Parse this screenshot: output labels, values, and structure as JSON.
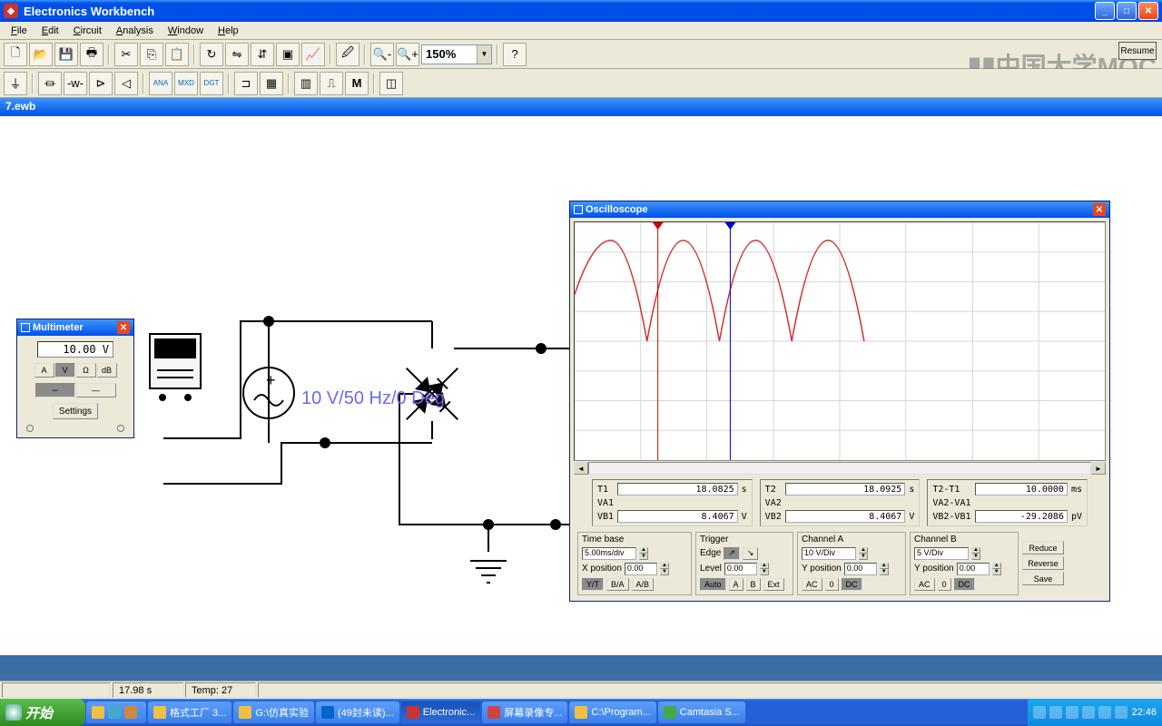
{
  "appTitle": "Electronics Workbench",
  "menus": [
    "File",
    "Edit",
    "Circuit",
    "Analysis",
    "Window",
    "Help"
  ],
  "zoom": "150%",
  "resumeBtn": "Resume",
  "watermark": "中国大学MOC",
  "docName": "7.ewb",
  "sourceLabel": "10 V/50 Hz/0 Deg",
  "multimeter": {
    "title": "Multimeter",
    "display": "10.00  V",
    "modes": [
      "A",
      "V",
      "Ω",
      "dB"
    ],
    "sigs": [
      "∼",
      "—"
    ],
    "settings": "Settings"
  },
  "scope": {
    "title": "Oscilloscope",
    "readouts": {
      "t1": {
        "lbl": "T1",
        "val": "18.0825",
        "unit": "s"
      },
      "va1": {
        "lbl": "VA1",
        "val": "",
        "unit": ""
      },
      "vb1": {
        "lbl": "VB1",
        "val": "8.4067",
        "unit": "V"
      },
      "t2": {
        "lbl": "T2",
        "val": "18.0925",
        "unit": "s"
      },
      "va2": {
        "lbl": "VA2",
        "val": "",
        "unit": ""
      },
      "vb2": {
        "lbl": "VB2",
        "val": "8.4067",
        "unit": "V"
      },
      "dt": {
        "lbl": "T2-T1",
        "val": "10.0000",
        "unit": "ms"
      },
      "dva": {
        "lbl": "VA2-VA1",
        "val": "",
        "unit": ""
      },
      "dvb": {
        "lbl": "VB2-VB1",
        "val": "-29.2086",
        "unit": "pV"
      }
    },
    "timebase": {
      "hdr": "Time base",
      "val": "5.00ms/div",
      "xposLbl": "X position",
      "xpos": "0.00",
      "btns": [
        "Y/T",
        "B/A",
        "A/B"
      ]
    },
    "trigger": {
      "hdr": "Trigger",
      "edgeLbl": "Edge",
      "levelLbl": "Level",
      "level": "0.00",
      "btns": [
        "Auto",
        "A",
        "B",
        "Ext"
      ]
    },
    "chA": {
      "hdr": "Channel A",
      "val": "10 V/Div",
      "yposLbl": "Y position",
      "ypos": "0.00",
      "btns": [
        "AC",
        "0",
        "DC"
      ]
    },
    "chB": {
      "hdr": "Channel B",
      "val": "5 V/Div",
      "yposLbl": "Y position",
      "ypos": "0.00",
      "btns": [
        "AC",
        "0",
        "DC"
      ]
    },
    "sidebtns": [
      "Reduce",
      "Reverse",
      "Save"
    ]
  },
  "status": {
    "time": "17.98 s",
    "temp": "Temp:  27"
  },
  "taskbar": {
    "start": "开始",
    "items": [
      "",
      "格式工厂 3...",
      "G:\\仿真实验",
      "(49封未读)...",
      "Electronic...",
      "屏幕录像专...",
      "C:\\Program...",
      "Camtasia S..."
    ],
    "clock": "22:46"
  }
}
